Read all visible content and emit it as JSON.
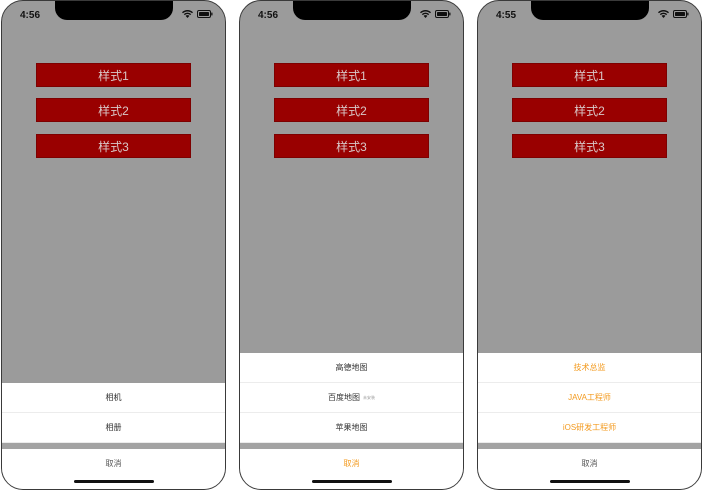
{
  "phones": [
    {
      "status_time": "4:56",
      "buttons": [
        "样式1",
        "样式2",
        "样式3"
      ],
      "sheet_items": [
        {
          "label": "相机"
        },
        {
          "label": "相册"
        }
      ],
      "cancel_label": "取消"
    },
    {
      "status_time": "4:56",
      "buttons": [
        "样式1",
        "样式2",
        "样式3"
      ],
      "sheet_items": [
        {
          "label": "高德地图"
        },
        {
          "label": "百度地图",
          "tag": "未安装"
        },
        {
          "label": "苹果地图"
        }
      ],
      "cancel_label": "取消"
    },
    {
      "status_time": "4:55",
      "buttons": [
        "样式1",
        "样式2",
        "样式3"
      ],
      "sheet_items": [
        {
          "label": "技术总监"
        },
        {
          "label": "JAVA工程师"
        },
        {
          "label": "iOS研发工程师"
        }
      ],
      "cancel_label": "取消"
    }
  ],
  "colors": {
    "backdrop": "#9b9b9b",
    "button_fill": "#990000",
    "accent_orange": "#f39a1e"
  },
  "icons": [
    "wifi-icon",
    "battery-icon"
  ]
}
